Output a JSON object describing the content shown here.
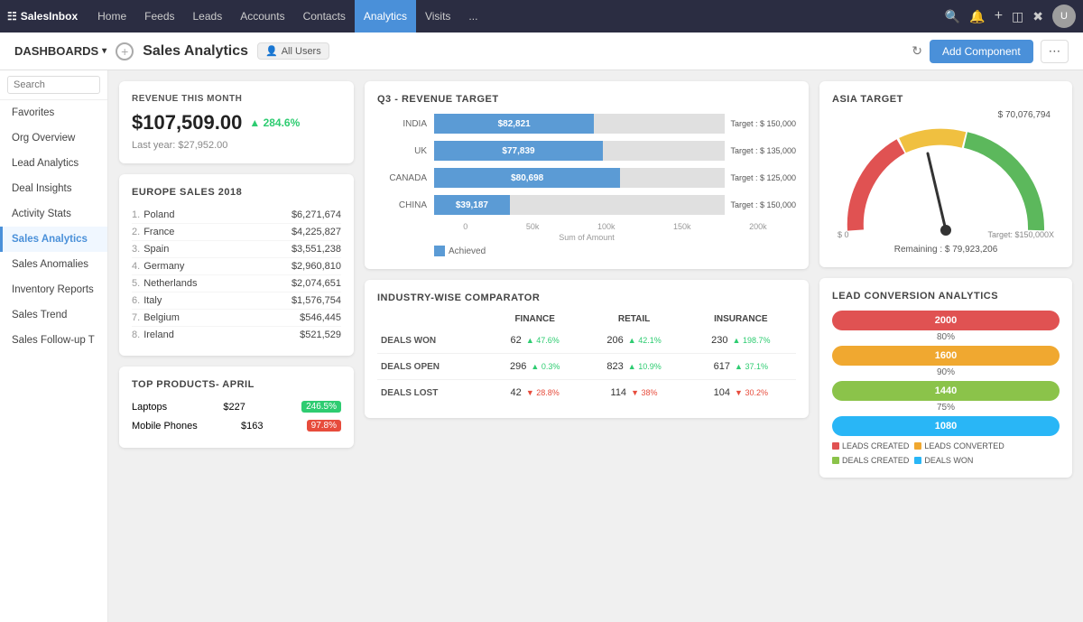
{
  "nav": {
    "brand": "SalesInbox",
    "items": [
      "Home",
      "Feeds",
      "Leads",
      "Accounts",
      "Contacts",
      "Analytics",
      "Visits",
      "..."
    ],
    "active": "Analytics",
    "icons": [
      "search",
      "bell",
      "plus",
      "grid",
      "x"
    ]
  },
  "toolbar": {
    "dashboards_label": "DASHBOARDS",
    "page_title": "Sales Analytics",
    "all_users_label": "All Users",
    "add_component_label": "Add Component"
  },
  "sidebar": {
    "search_placeholder": "Search",
    "items": [
      {
        "label": "Favorites"
      },
      {
        "label": "Org Overview"
      },
      {
        "label": "Lead Analytics"
      },
      {
        "label": "Deal Insights"
      },
      {
        "label": "Activity Stats"
      },
      {
        "label": "Sales Analytics",
        "active": true
      },
      {
        "label": "Sales Anomalies"
      },
      {
        "label": "Inventory Reports"
      },
      {
        "label": "Sales Trend"
      },
      {
        "label": "Sales Follow-up T"
      }
    ]
  },
  "revenue": {
    "title": "REVENUE THIS MONTH",
    "amount": "$107,509.00",
    "change": "284.6%",
    "last_year_label": "Last year: $27,952.00"
  },
  "europe_sales": {
    "title": "EUROPE SALES 2018",
    "rows": [
      {
        "rank": "1.",
        "country": "Poland",
        "amount": "$6,271,674"
      },
      {
        "rank": "2.",
        "country": "France",
        "amount": "$4,225,827"
      },
      {
        "rank": "3.",
        "country": "Spain",
        "amount": "$3,551,238"
      },
      {
        "rank": "4.",
        "country": "Germany",
        "amount": "$2,960,810"
      },
      {
        "rank": "5.",
        "country": "Netherlands",
        "amount": "$2,074,651"
      },
      {
        "rank": "6.",
        "country": "Italy",
        "amount": "$1,576,754"
      },
      {
        "rank": "7.",
        "country": "Belgium",
        "amount": "$546,445"
      },
      {
        "rank": "8.",
        "country": "Ireland",
        "amount": "$521,529"
      }
    ]
  },
  "top_products": {
    "title": "TOP PRODUCTS- APRIL",
    "rows": [
      {
        "name": "Laptops",
        "price": "$227",
        "badge": "246.5%",
        "badge_type": "green"
      },
      {
        "name": "Mobile Phones",
        "price": "$163",
        "badge": "97.8%",
        "badge_type": "red"
      }
    ]
  },
  "q3_target": {
    "title": "Q3 - REVENUE TARGET",
    "bars": [
      {
        "label": "INDIA",
        "value": "$82,821",
        "fill_pct": 55,
        "target": "Target : $ 150,000"
      },
      {
        "label": "UK",
        "value": "$77,839",
        "fill_pct": 58,
        "target": "Target : $ 135,000"
      },
      {
        "label": "CANADA",
        "value": "$80,698",
        "fill_pct": 64,
        "target": "Target : $ 125,000"
      },
      {
        "label": "CHINA",
        "value": "$39,187",
        "fill_pct": 26,
        "target": "Target : $ 150,000"
      }
    ],
    "axis_labels": [
      "0",
      "50k",
      "100k",
      "150k",
      "200k"
    ],
    "legend_label": "Achieved"
  },
  "industry_comparator": {
    "title": "INDUSTRY-WISE COMPARATOR",
    "headers": [
      "",
      "FINANCE",
      "RETAIL",
      "INSURANCE"
    ],
    "rows": [
      {
        "label": "DEALS WON",
        "finance": {
          "value": "62",
          "change": "47.6%",
          "dir": "up"
        },
        "retail": {
          "value": "206",
          "change": "42.1%",
          "dir": "up"
        },
        "insurance": {
          "value": "230",
          "change": "198.7%",
          "dir": "up"
        }
      },
      {
        "label": "DEALS OPEN",
        "finance": {
          "value": "296",
          "change": "0.3%",
          "dir": "up"
        },
        "retail": {
          "value": "823",
          "change": "10.9%",
          "dir": "up"
        },
        "insurance": {
          "value": "617",
          "change": "37.1%",
          "dir": "up"
        }
      },
      {
        "label": "DEALS LOST",
        "finance": {
          "value": "42",
          "change": "28.8%",
          "dir": "down"
        },
        "retail": {
          "value": "114",
          "change": "38%",
          "dir": "down"
        },
        "insurance": {
          "value": "104",
          "change": "30.2%",
          "dir": "down"
        }
      }
    ]
  },
  "asia_target": {
    "title": "ASIA TARGET",
    "top_value": "$ 70,076,794",
    "left_label": "$ 0",
    "right_label": "Target: $150,000X",
    "remaining_label": "Remaining : $ 79,923,206"
  },
  "lead_conversion": {
    "title": "LEAD CONVERSION ANALYTICS",
    "bars": [
      {
        "value": "2000",
        "color": "#e05252",
        "pct": ""
      },
      {
        "value": "80%",
        "color": null,
        "pct": true
      },
      {
        "value": "1600",
        "color": "#f0a830",
        "pct": ""
      },
      {
        "value": "90%",
        "color": null,
        "pct": true
      },
      {
        "value": "1440",
        "color": "#8bc34a",
        "pct": ""
      },
      {
        "value": "75%",
        "color": null,
        "pct": true
      },
      {
        "value": "1080",
        "color": "#29b6f6",
        "pct": ""
      }
    ],
    "legend": [
      {
        "label": "LEADS CREATED",
        "color": "#e05252"
      },
      {
        "label": "LEADS CONVERTED",
        "color": "#f0a830"
      },
      {
        "label": "DEALS CREATED",
        "color": "#8bc34a"
      },
      {
        "label": "DEALS WON",
        "color": "#29b6f6"
      }
    ]
  }
}
